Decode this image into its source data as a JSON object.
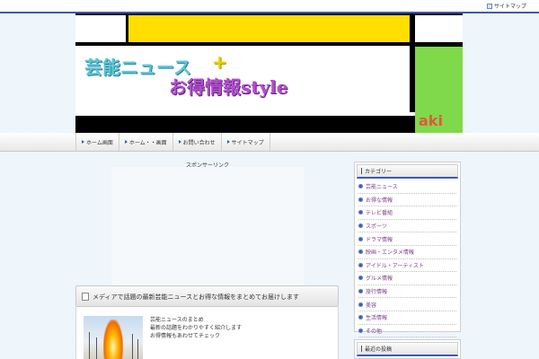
{
  "topbar": {
    "sitemap_label": "サイトマップ"
  },
  "banner": {
    "title_line1": "芸能ニュース",
    "plus": "+",
    "title_line2": "お得情報style",
    "corner": "aki",
    "colors": {
      "yellow": "#ffde00",
      "green": "#7fd94a",
      "cyan_text": "#5cc6d8",
      "purple_text": "#b34fd0"
    }
  },
  "nav": {
    "items": [
      {
        "label": "ホーム画面"
      },
      {
        "label": "ホーム・・画面"
      },
      {
        "label": "お問い合わせ"
      },
      {
        "label": "サイトマップ"
      }
    ]
  },
  "main": {
    "ad_label": "スポンサーリンク",
    "post": {
      "title": "メディアで話題の最新芸能ニュースとお得な情報をまとめてお届けします",
      "lines": [
        "芸能ニュースのまとめ",
        "最新の話題をわかりやすく紹介します",
        "お得情報もあわせてチェック"
      ]
    }
  },
  "sidebar": {
    "category_title": "カテゴリー",
    "categories": [
      "芸能ニュース",
      "お得な情報",
      "テレビ番組",
      "スポーツ",
      "ドラマ情報",
      "映画・エンタメ情報",
      "アイドル・アーティスト",
      "グルメ情報",
      "旅行情報",
      "美容",
      "生活情報",
      "その他"
    ],
    "second_title": "最近の投稿"
  }
}
